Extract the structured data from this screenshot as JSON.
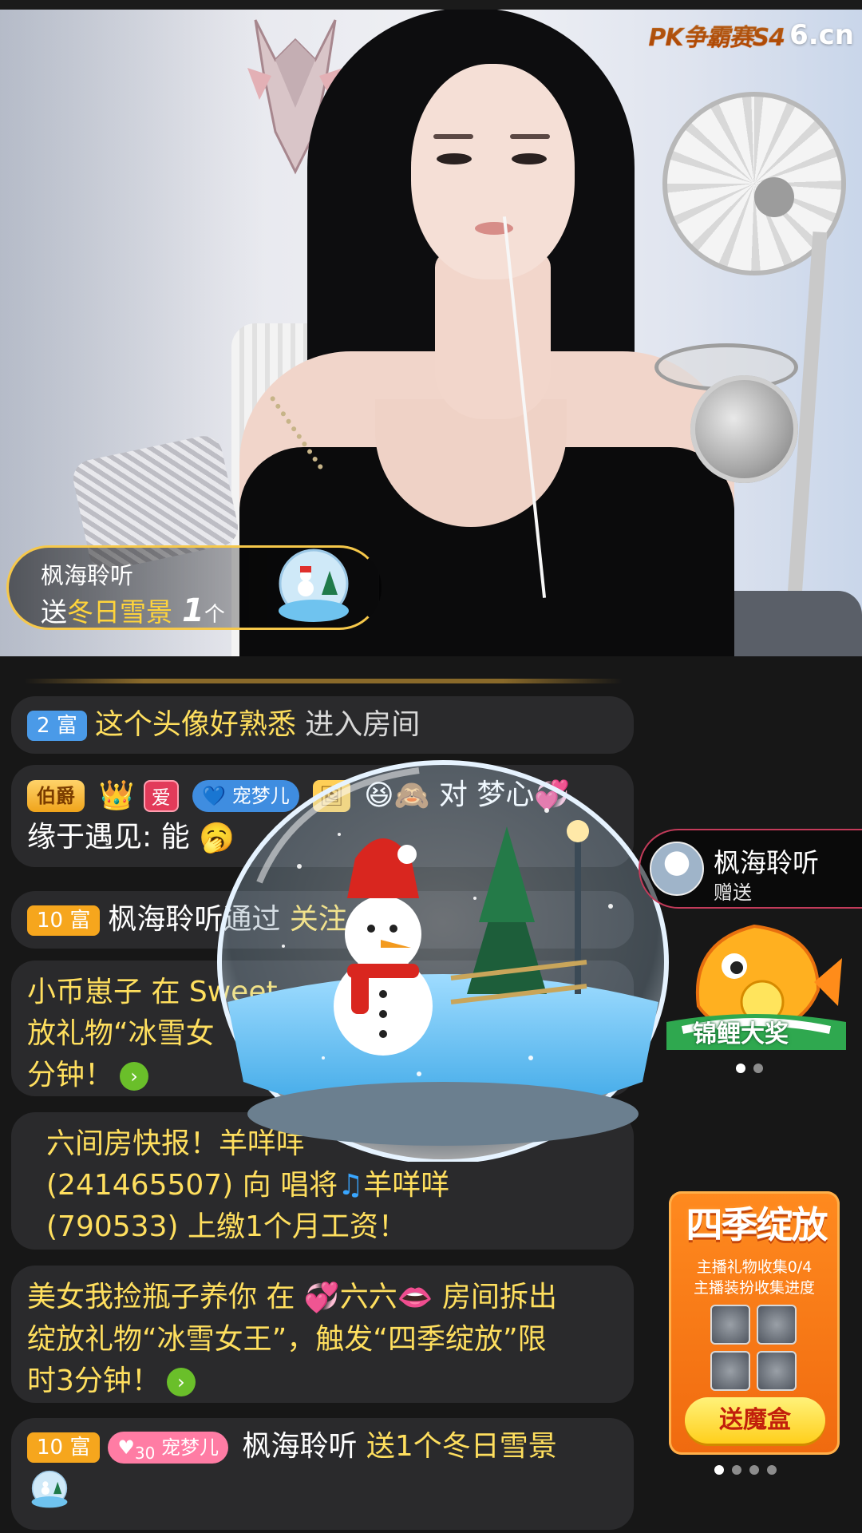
{
  "brand": {
    "event_logo": "PK争霸赛S4",
    "site_logo": "6.cn"
  },
  "gift_toast": {
    "sender": "枫海聆听",
    "verb": "送",
    "gift_name": "冬日雪景",
    "count": "1",
    "unit": "个"
  },
  "chat": [
    {
      "level": "2",
      "level_word": "富",
      "user": "这个头像好熟悉",
      "action": "进入房间"
    },
    {
      "badge_duke": "伯爵",
      "badge_love": "爱",
      "badge_pet": "宠梦儿",
      "target_prefix": "对",
      "target": "梦心",
      "line2": "缘于遇见: 能"
    },
    {
      "level": "10",
      "level_word": "富",
      "user": "枫海聆听",
      "via": "通过",
      "action": "关注"
    },
    {
      "text": "小币崽子 在 Sweet",
      "text2": "放礼物“冰雪女",
      "text3": "分钟！"
    },
    {
      "line1": "六间房快报！羊咩咩",
      "line2_a": "(241465507) 向 唱将",
      "line2_b": "羊咩咩",
      "line3": "(790533) 上缴1个月工资！"
    },
    {
      "line1_a": "美女我捡瓶子养你 在",
      "line1_b": "六六",
      "line1_c": "房间拆出",
      "line2": "绽放礼物“冰雪女王”，触发“四季绽放”限",
      "line3": "时3分钟！"
    },
    {
      "level": "10",
      "level_word": "富",
      "pet_level": "30",
      "pet_name": "宠梦儿",
      "user": "枫海聆听",
      "gift_text": "送1个冬日雪景"
    }
  ],
  "sender_card": {
    "name": "枫海聆听",
    "sub": "赠送"
  },
  "koi_promo": {
    "label": "锦鲤大奖"
  },
  "season_card": {
    "title": "四季绽放",
    "line1": "主播礼物收集0/4",
    "line2": "主播装扮收集进度",
    "button": "送魔盒"
  },
  "icons": [
    "pk-logo",
    "crown-icon",
    "heart-icon",
    "avatar-frame-icon",
    "laugh-emoji-icon",
    "monkey-emoji-icon",
    "hearts-emoji-icon",
    "yawn-emoji-icon",
    "go-arrow-icon",
    "music-note-icon",
    "lips-emoji-icon",
    "snow-globe-icon"
  ],
  "colors": {
    "accent_yellow": "#ffdf5e",
    "level_blue": "#4a9ae8",
    "level_orange": "#f6a61d",
    "season_orange": "#f06a0f"
  }
}
